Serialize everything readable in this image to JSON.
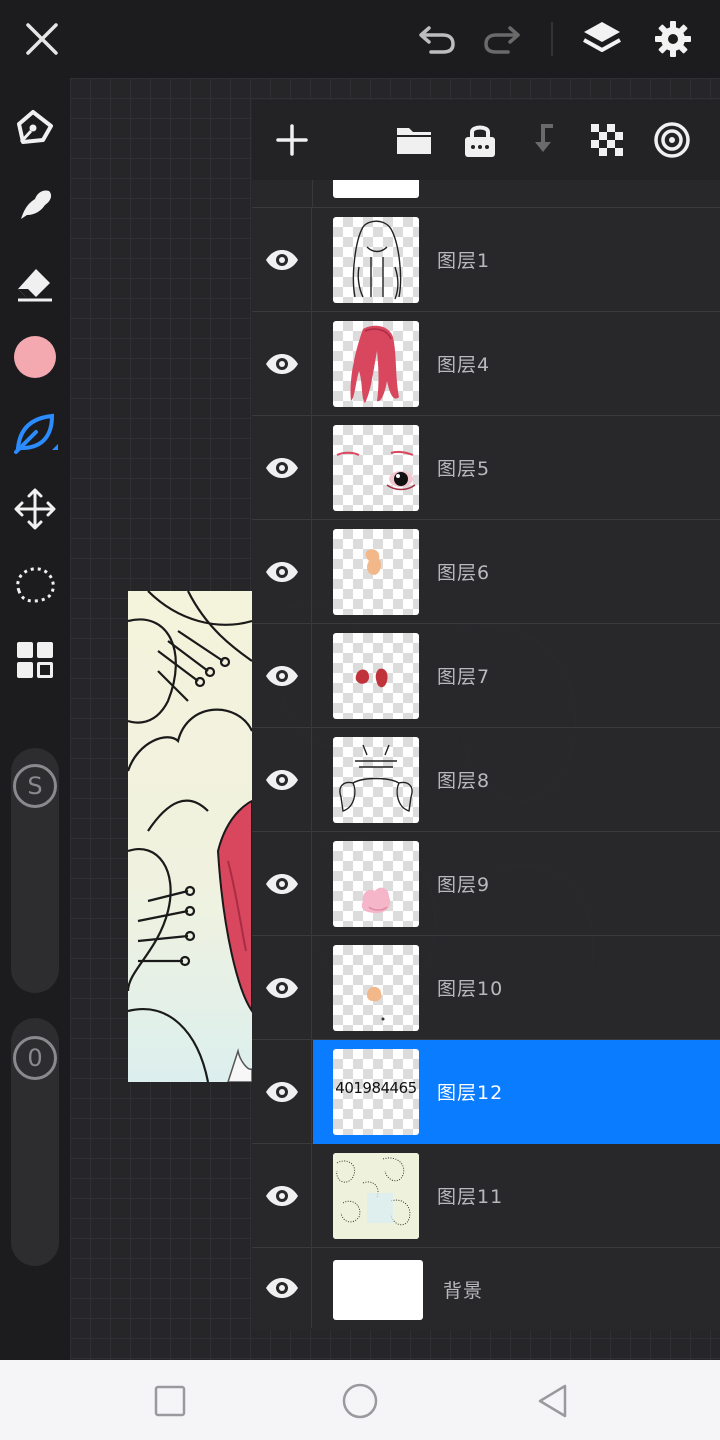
{
  "app": {
    "top_bar": {
      "close_icon": "close-icon",
      "undo_icon": "undo-icon",
      "redo_icon": "redo-icon",
      "layers_icon": "layers-icon",
      "settings_icon": "gear-icon"
    },
    "tools": {
      "items": [
        "pen-tool-icon",
        "smudge-tool-icon",
        "eraser-tool-icon",
        "color-swatch",
        "leaf-brush-icon",
        "move-transform-icon",
        "lasso-select-icon",
        "gallery-grid-icon"
      ],
      "active_color": "#f4a9b0",
      "active_tool_color": "#2b8cff",
      "size_slider_label": "S",
      "opacity_slider_label": "0"
    },
    "layers_panel": {
      "toolbar": [
        "add-layer-icon",
        "folder-icon",
        "lock-icon",
        "merge-down-icon",
        "transparency-checker-icon",
        "layer-mode-icon"
      ],
      "layers": [
        {
          "name": "图层1",
          "visible": true,
          "selected": false
        },
        {
          "name": "图层4",
          "visible": true,
          "selected": false
        },
        {
          "name": "图层5",
          "visible": true,
          "selected": false
        },
        {
          "name": "图层6",
          "visible": true,
          "selected": false
        },
        {
          "name": "图层7",
          "visible": true,
          "selected": false
        },
        {
          "name": "图层8",
          "visible": true,
          "selected": false
        },
        {
          "name": "图层9",
          "visible": true,
          "selected": false
        },
        {
          "name": "图层10",
          "visible": true,
          "selected": false
        },
        {
          "name": "图层12",
          "visible": true,
          "selected": true,
          "thumb_text": "401984465"
        },
        {
          "name": "图层11",
          "visible": true,
          "selected": false
        }
      ],
      "background_layer": {
        "name": "背景",
        "visible": true
      }
    },
    "colors": {
      "selected_row": "#0a7cff",
      "panel_bg": "#28282b",
      "topbar_bg": "#1c1c1e"
    },
    "nav": {
      "recent_icon": "square-icon",
      "home_icon": "circle-icon",
      "back_icon": "triangle-back-icon"
    }
  }
}
